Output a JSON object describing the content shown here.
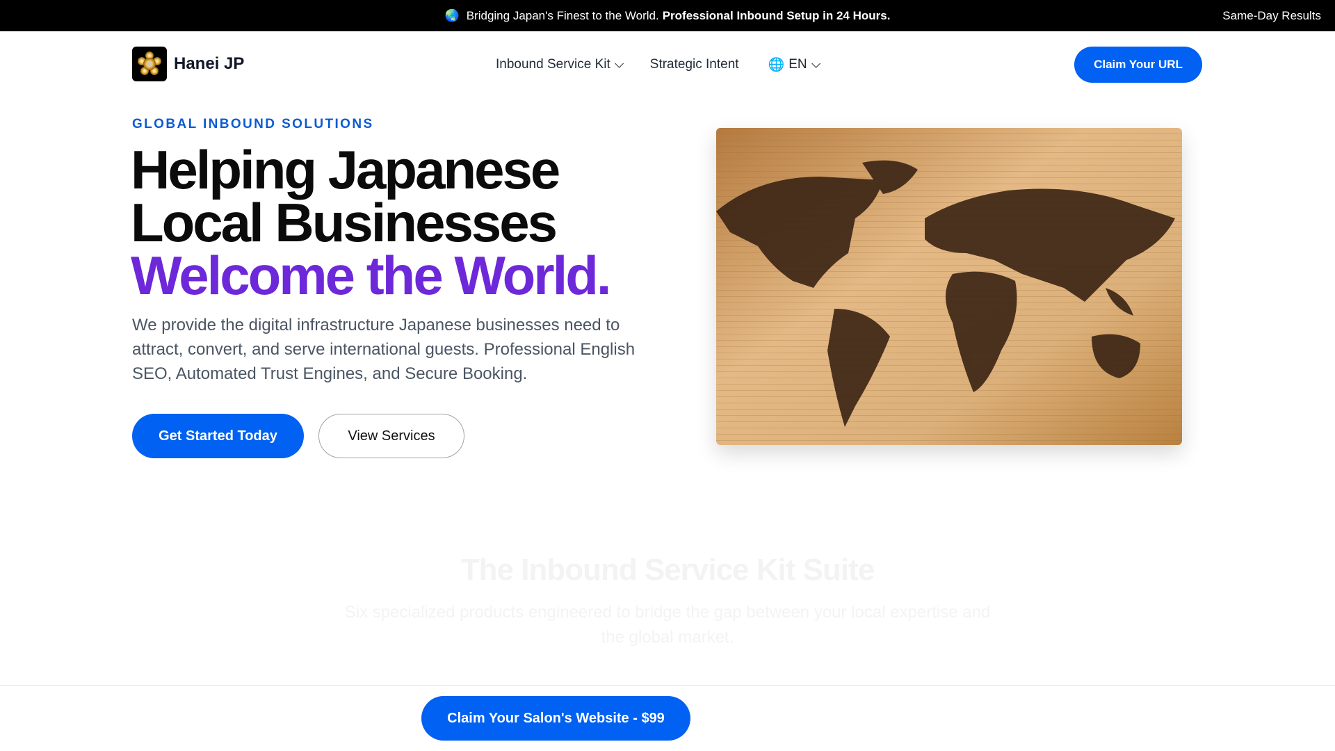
{
  "announcement": {
    "globe_icon": "globe-asia-icon",
    "text": "Bridging Japan's Finest to the World.",
    "bold": "Professional Inbound Setup in 24 Hours.",
    "right": "Same-Day Results"
  },
  "nav": {
    "brand": "Hanei JP",
    "logo_icon": "golden-flower-icon",
    "links": [
      {
        "label": "Inbound Service Kit",
        "dropdown": true
      },
      {
        "label": "Strategic Intent"
      }
    ],
    "language": "EN",
    "language_icon": "globe-icon",
    "cta": "Claim Your URL"
  },
  "hero": {
    "eyebrow": "GLOBAL INBOUND SOLUTIONS",
    "title_line1": "Helping Japanese",
    "title_line2": "Local Businesses",
    "title_accent": "Welcome the World.",
    "lead": "We provide the digital infrastructure Japanese businesses need to attract, convert, and serve international guests. Professional English SEO, Automated Trust Engines, and Secure Booking.",
    "primary_cta": "Get Started Today",
    "secondary_cta": "View Services",
    "image": "wooden-world-map"
  },
  "suite": {
    "title": "The Inbound Service Kit Suite",
    "subtitle": "Six specialized products engineered to bridge the gap between your local expertise and the global market."
  },
  "sticky": {
    "cta": "Claim Your Salon's Website - $99"
  },
  "colors": {
    "primary": "#0061f2",
    "accent": "#6d28d9",
    "eyebrow": "#0b5bd3"
  }
}
